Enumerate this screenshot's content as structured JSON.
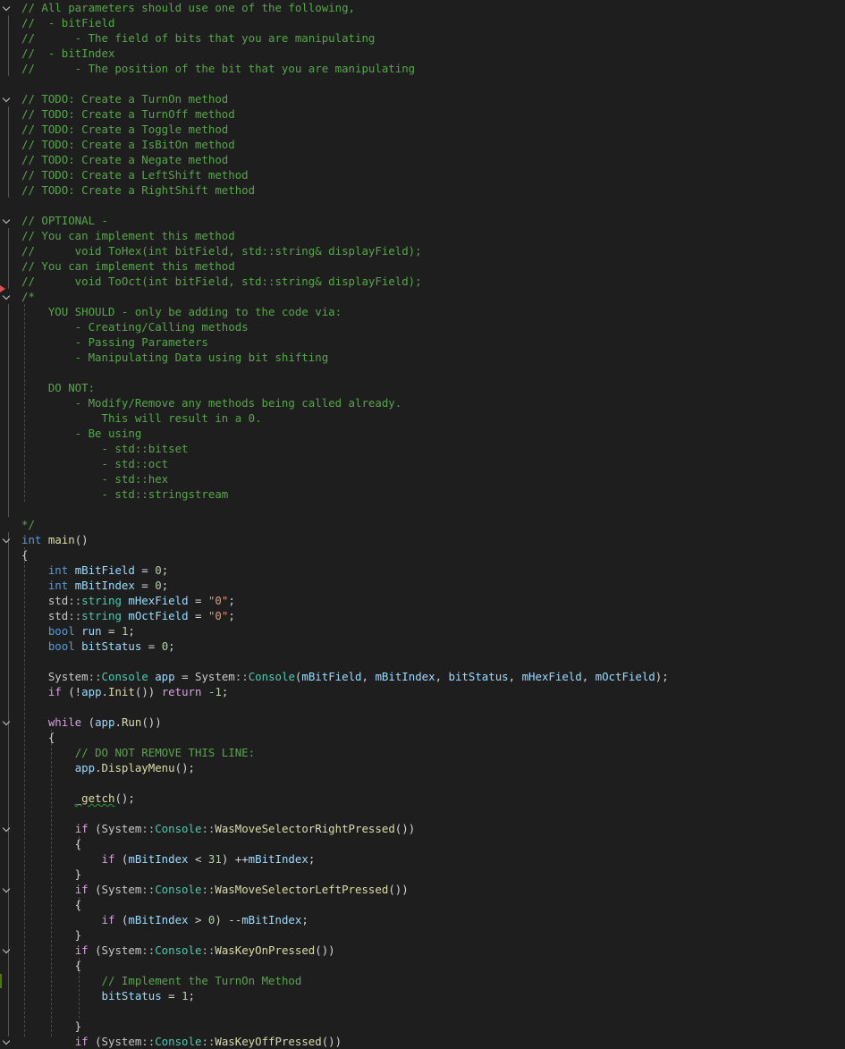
{
  "editor": {
    "lines": [
      {
        "fold": true,
        "tokens": [
          {
            "t": "// All parameters should use one of the following,",
            "c": "comment"
          }
        ]
      },
      {
        "fold": false,
        "tokens": [
          {
            "t": "//  - bitField",
            "c": "comment"
          }
        ]
      },
      {
        "fold": false,
        "tokens": [
          {
            "t": "//      - The field of bits that you are manipulating",
            "c": "comment"
          }
        ]
      },
      {
        "fold": false,
        "tokens": [
          {
            "t": "//  - bitIndex",
            "c": "comment"
          }
        ]
      },
      {
        "fold": false,
        "tokens": [
          {
            "t": "//      - The position of the bit that you are manipulating",
            "c": "comment"
          }
        ]
      },
      {
        "fold": false,
        "tokens": []
      },
      {
        "fold": true,
        "tokens": [
          {
            "t": "// TODO: Create a TurnOn method",
            "c": "comment"
          }
        ]
      },
      {
        "fold": false,
        "tokens": [
          {
            "t": "// TODO: Create a TurnOff method",
            "c": "comment"
          }
        ]
      },
      {
        "fold": false,
        "tokens": [
          {
            "t": "// TODO: Create a Toggle method",
            "c": "comment"
          }
        ]
      },
      {
        "fold": false,
        "tokens": [
          {
            "t": "// TODO: Create a IsBitOn method",
            "c": "comment"
          }
        ]
      },
      {
        "fold": false,
        "tokens": [
          {
            "t": "// TODO: Create a Negate method",
            "c": "comment"
          }
        ]
      },
      {
        "fold": false,
        "tokens": [
          {
            "t": "// TODO: Create a LeftShift method",
            "c": "comment"
          }
        ]
      },
      {
        "fold": false,
        "tokens": [
          {
            "t": "// TODO: Create a RightShift method",
            "c": "comment"
          }
        ]
      },
      {
        "fold": false,
        "tokens": []
      },
      {
        "fold": true,
        "tokens": [
          {
            "t": "// OPTIONAL -",
            "c": "comment"
          }
        ]
      },
      {
        "fold": false,
        "tokens": [
          {
            "t": "// You can implement this method",
            "c": "comment"
          }
        ]
      },
      {
        "fold": false,
        "tokens": [
          {
            "t": "//      void ToHex(int bitField, std::string& displayField);",
            "c": "comment"
          }
        ]
      },
      {
        "fold": false,
        "tokens": [
          {
            "t": "// You can implement this method",
            "c": "comment"
          }
        ]
      },
      {
        "fold": false,
        "tokens": [
          {
            "t": "//      void ToOct(int bitField, std::string& displayField);",
            "c": "comment"
          }
        ]
      },
      {
        "fold": true,
        "tokens": [
          {
            "t": "/*",
            "c": "comment"
          }
        ]
      },
      {
        "fold": false,
        "tokens": [
          {
            "t": "    YOU SHOULD - only be adding to the code via:",
            "c": "comment"
          }
        ]
      },
      {
        "fold": false,
        "tokens": [
          {
            "t": "        - Creating/Calling methods",
            "c": "comment"
          }
        ]
      },
      {
        "fold": false,
        "tokens": [
          {
            "t": "        - Passing Parameters",
            "c": "comment"
          }
        ]
      },
      {
        "fold": false,
        "tokens": [
          {
            "t": "        - Manipulating Data using bit shifting",
            "c": "comment"
          }
        ]
      },
      {
        "fold": false,
        "tokens": []
      },
      {
        "fold": false,
        "tokens": [
          {
            "t": "    DO NOT:",
            "c": "comment"
          }
        ]
      },
      {
        "fold": false,
        "tokens": [
          {
            "t": "        - Modify/Remove any methods being called already.",
            "c": "comment"
          }
        ]
      },
      {
        "fold": false,
        "tokens": [
          {
            "t": "            This will result in a 0.",
            "c": "comment"
          }
        ]
      },
      {
        "fold": false,
        "tokens": [
          {
            "t": "        - Be using",
            "c": "comment"
          }
        ]
      },
      {
        "fold": false,
        "tokens": [
          {
            "t": "            - std::bitset",
            "c": "comment"
          }
        ]
      },
      {
        "fold": false,
        "tokens": [
          {
            "t": "            - std::oct",
            "c": "comment"
          }
        ]
      },
      {
        "fold": false,
        "tokens": [
          {
            "t": "            - std::hex",
            "c": "comment"
          }
        ]
      },
      {
        "fold": false,
        "tokens": [
          {
            "t": "            - std::stringstream",
            "c": "comment"
          }
        ]
      },
      {
        "fold": false,
        "tokens": []
      },
      {
        "fold": false,
        "tokens": [
          {
            "t": "*/",
            "c": "comment"
          }
        ]
      },
      {
        "fold": true,
        "tokens": [
          {
            "t": "int",
            "c": "kw"
          },
          {
            "t": " "
          },
          {
            "t": "main",
            "c": "fn"
          },
          {
            "t": "()"
          }
        ]
      },
      {
        "fold": false,
        "tokens": [
          {
            "t": "{"
          }
        ]
      },
      {
        "fold": false,
        "tokens": [
          {
            "t": "    "
          },
          {
            "t": "int",
            "c": "kw"
          },
          {
            "t": " "
          },
          {
            "t": "mBitField",
            "c": "var"
          },
          {
            "t": " = "
          },
          {
            "t": "0",
            "c": "num"
          },
          {
            "t": ";"
          }
        ]
      },
      {
        "fold": false,
        "tokens": [
          {
            "t": "    "
          },
          {
            "t": "int",
            "c": "kw"
          },
          {
            "t": " "
          },
          {
            "t": "mBitIndex",
            "c": "var"
          },
          {
            "t": " = "
          },
          {
            "t": "0",
            "c": "num"
          },
          {
            "t": ";"
          }
        ]
      },
      {
        "fold": false,
        "tokens": [
          {
            "t": "    "
          },
          {
            "t": "std",
            "c": "ns"
          },
          {
            "t": "::",
            "c": "op"
          },
          {
            "t": "string",
            "c": "type"
          },
          {
            "t": " "
          },
          {
            "t": "mHexField",
            "c": "var"
          },
          {
            "t": " = "
          },
          {
            "t": "\"0\"",
            "c": "str"
          },
          {
            "t": ";"
          }
        ]
      },
      {
        "fold": false,
        "tokens": [
          {
            "t": "    "
          },
          {
            "t": "std",
            "c": "ns"
          },
          {
            "t": "::",
            "c": "op"
          },
          {
            "t": "string",
            "c": "type"
          },
          {
            "t": " "
          },
          {
            "t": "mOctField",
            "c": "var"
          },
          {
            "t": " = "
          },
          {
            "t": "\"0\"",
            "c": "str"
          },
          {
            "t": ";"
          }
        ]
      },
      {
        "fold": false,
        "tokens": [
          {
            "t": "    "
          },
          {
            "t": "bool",
            "c": "kw"
          },
          {
            "t": " "
          },
          {
            "t": "run",
            "c": "var"
          },
          {
            "t": " = "
          },
          {
            "t": "1",
            "c": "num"
          },
          {
            "t": ";"
          }
        ]
      },
      {
        "fold": false,
        "tokens": [
          {
            "t": "    "
          },
          {
            "t": "bool",
            "c": "kw"
          },
          {
            "t": " "
          },
          {
            "t": "bitStatus",
            "c": "var"
          },
          {
            "t": " = "
          },
          {
            "t": "0",
            "c": "num"
          },
          {
            "t": ";"
          }
        ]
      },
      {
        "fold": false,
        "tokens": []
      },
      {
        "fold": false,
        "tokens": [
          {
            "t": "    "
          },
          {
            "t": "System",
            "c": "ns"
          },
          {
            "t": "::",
            "c": "op"
          },
          {
            "t": "Console",
            "c": "type"
          },
          {
            "t": " "
          },
          {
            "t": "app",
            "c": "var"
          },
          {
            "t": " = "
          },
          {
            "t": "System",
            "c": "ns"
          },
          {
            "t": "::",
            "c": "op"
          },
          {
            "t": "Console",
            "c": "type"
          },
          {
            "t": "("
          },
          {
            "t": "mBitField",
            "c": "var"
          },
          {
            "t": ", "
          },
          {
            "t": "mBitIndex",
            "c": "var"
          },
          {
            "t": ", "
          },
          {
            "t": "bitStatus",
            "c": "var"
          },
          {
            "t": ", "
          },
          {
            "t": "mHexField",
            "c": "var"
          },
          {
            "t": ", "
          },
          {
            "t": "mOctField",
            "c": "var"
          },
          {
            "t": ");"
          }
        ]
      },
      {
        "fold": false,
        "tokens": [
          {
            "t": "    "
          },
          {
            "t": "if",
            "c": "flow"
          },
          {
            "t": " (!"
          },
          {
            "t": "app",
            "c": "var"
          },
          {
            "t": "."
          },
          {
            "t": "Init",
            "c": "fn"
          },
          {
            "t": "()) "
          },
          {
            "t": "return",
            "c": "flow"
          },
          {
            "t": " "
          },
          {
            "t": "-1",
            "c": "num"
          },
          {
            "t": ";"
          }
        ]
      },
      {
        "fold": false,
        "tokens": []
      },
      {
        "fold": true,
        "tokens": [
          {
            "t": "    "
          },
          {
            "t": "while",
            "c": "flow"
          },
          {
            "t": " ("
          },
          {
            "t": "app",
            "c": "var"
          },
          {
            "t": "."
          },
          {
            "t": "Run",
            "c": "fn"
          },
          {
            "t": "())"
          }
        ]
      },
      {
        "fold": false,
        "tokens": [
          {
            "t": "    {"
          }
        ]
      },
      {
        "fold": false,
        "tokens": [
          {
            "t": "        "
          },
          {
            "t": "// DO NOT REMOVE THIS LINE:",
            "c": "comment"
          }
        ]
      },
      {
        "fold": false,
        "tokens": [
          {
            "t": "        "
          },
          {
            "t": "app",
            "c": "var"
          },
          {
            "t": "."
          },
          {
            "t": "DisplayMenu",
            "c": "fn"
          },
          {
            "t": "();"
          }
        ]
      },
      {
        "fold": false,
        "tokens": []
      },
      {
        "fold": false,
        "tokens": [
          {
            "t": "        "
          },
          {
            "t": "_getch",
            "c": "fn",
            "sq": true
          },
          {
            "t": "();"
          }
        ]
      },
      {
        "fold": false,
        "tokens": []
      },
      {
        "fold": true,
        "tokens": [
          {
            "t": "        "
          },
          {
            "t": "if",
            "c": "flow"
          },
          {
            "t": " ("
          },
          {
            "t": "System",
            "c": "ns"
          },
          {
            "t": "::",
            "c": "op"
          },
          {
            "t": "Console",
            "c": "type"
          },
          {
            "t": "::",
            "c": "op"
          },
          {
            "t": "WasMoveSelectorRightPressed",
            "c": "fn"
          },
          {
            "t": "())"
          }
        ]
      },
      {
        "fold": false,
        "tokens": [
          {
            "t": "        {"
          }
        ]
      },
      {
        "fold": false,
        "tokens": [
          {
            "t": "            "
          },
          {
            "t": "if",
            "c": "flow"
          },
          {
            "t": " ("
          },
          {
            "t": "mBitIndex",
            "c": "var"
          },
          {
            "t": " < "
          },
          {
            "t": "31",
            "c": "num"
          },
          {
            "t": ") ++"
          },
          {
            "t": "mBitIndex",
            "c": "var"
          },
          {
            "t": ";"
          }
        ]
      },
      {
        "fold": false,
        "tokens": [
          {
            "t": "        }"
          }
        ]
      },
      {
        "fold": true,
        "tokens": [
          {
            "t": "        "
          },
          {
            "t": "if",
            "c": "flow"
          },
          {
            "t": " ("
          },
          {
            "t": "System",
            "c": "ns"
          },
          {
            "t": "::",
            "c": "op"
          },
          {
            "t": "Console",
            "c": "type"
          },
          {
            "t": "::",
            "c": "op"
          },
          {
            "t": "WasMoveSelectorLeftPressed",
            "c": "fn"
          },
          {
            "t": "())"
          }
        ]
      },
      {
        "fold": false,
        "tokens": [
          {
            "t": "        {"
          }
        ]
      },
      {
        "fold": false,
        "tokens": [
          {
            "t": "            "
          },
          {
            "t": "if",
            "c": "flow"
          },
          {
            "t": " ("
          },
          {
            "t": "mBitIndex",
            "c": "var"
          },
          {
            "t": " > "
          },
          {
            "t": "0",
            "c": "num"
          },
          {
            "t": ") --"
          },
          {
            "t": "mBitIndex",
            "c": "var"
          },
          {
            "t": ";"
          }
        ]
      },
      {
        "fold": false,
        "tokens": [
          {
            "t": "        }"
          }
        ]
      },
      {
        "fold": true,
        "tokens": [
          {
            "t": "        "
          },
          {
            "t": "if",
            "c": "flow"
          },
          {
            "t": " ("
          },
          {
            "t": "System",
            "c": "ns"
          },
          {
            "t": "::",
            "c": "op"
          },
          {
            "t": "Console",
            "c": "type"
          },
          {
            "t": "::",
            "c": "op"
          },
          {
            "t": "WasKeyOnPressed",
            "c": "fn"
          },
          {
            "t": "())"
          }
        ]
      },
      {
        "fold": false,
        "tokens": [
          {
            "t": "        {"
          }
        ]
      },
      {
        "fold": false,
        "tokens": [
          {
            "t": "            "
          },
          {
            "t": "// Implement the TurnOn Method",
            "c": "comment"
          }
        ]
      },
      {
        "fold": false,
        "tokens": [
          {
            "t": "            "
          },
          {
            "t": "bitStatus",
            "c": "var"
          },
          {
            "t": " = "
          },
          {
            "t": "1",
            "c": "num"
          },
          {
            "t": ";"
          }
        ]
      },
      {
        "fold": false,
        "tokens": []
      },
      {
        "fold": false,
        "tokens": [
          {
            "t": "        }"
          }
        ]
      },
      {
        "fold": true,
        "tokens": [
          {
            "t": "        "
          },
          {
            "t": "if",
            "c": "flow"
          },
          {
            "t": " ("
          },
          {
            "t": "System",
            "c": "ns"
          },
          {
            "t": "::",
            "c": "op"
          },
          {
            "t": "Console",
            "c": "type"
          },
          {
            "t": "::",
            "c": "op"
          },
          {
            "t": "WasKeyOffPressed",
            "c": "fn"
          },
          {
            "t": "())"
          }
        ]
      }
    ]
  }
}
